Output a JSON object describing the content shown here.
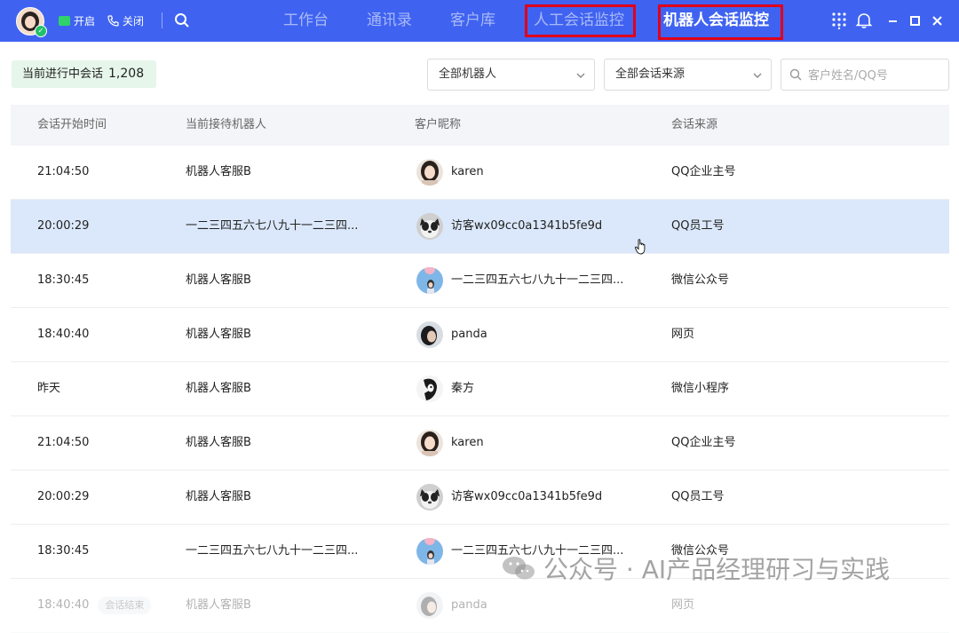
{
  "topbar": {
    "open_label": "开启",
    "close_label": "关闭",
    "nav": [
      "工作台",
      "通讯录",
      "客户库",
      "人工会话监控",
      "机器人会话监控"
    ],
    "active_nav": "机器人会话监控"
  },
  "toolbar": {
    "label": "当前进行中会话",
    "count": "1,208",
    "robot_filter": "全部机器人",
    "source_filter": "全部会话来源",
    "search_placeholder": "客户姓名/QQ号"
  },
  "table": {
    "headers": [
      "会话开始时间",
      "当前接待机器人",
      "客户昵称",
      "会话来源"
    ],
    "rows": [
      {
        "time": "21:04:50",
        "robot": "机器人客服B",
        "customer": "karen",
        "avatar": "woman-avatar",
        "source": "QQ企业主号"
      },
      {
        "time": "20:00:29",
        "robot": "一二三四五六七八九十一二三四...",
        "customer": "访客wx09cc0a1341b5fe9d",
        "avatar": "cat-avatar",
        "source": "QQ员工号"
      },
      {
        "time": "18:30:45",
        "robot": "机器人客服B",
        "customer": "一二三四五六七八九十一二三四...",
        "avatar": "girl-sky-avatar",
        "source": "微信公众号"
      },
      {
        "time": "18:40:40",
        "robot": "机器人客服B",
        "customer": "panda",
        "avatar": "man-avatar",
        "source": "网页"
      },
      {
        "time": "昨天",
        "robot": "机器人客服B",
        "customer": "秦方",
        "avatar": "sketch-avatar",
        "source": "微信小程序"
      },
      {
        "time": "21:04:50",
        "robot": "机器人客服B",
        "customer": "karen",
        "avatar": "woman-avatar",
        "source": "QQ企业主号"
      },
      {
        "time": "20:00:29",
        "robot": "机器人客服B",
        "customer": "访客wx09cc0a1341b5fe9d",
        "avatar": "cat-avatar",
        "source": "QQ员工号"
      },
      {
        "time": "18:30:45",
        "robot": "一二三四五六七八九十一二三四...",
        "customer": "一二三四五六七八九十一二三四...",
        "avatar": "girl-sky-avatar",
        "source": "微信公众号"
      },
      {
        "time": "18:40:40",
        "badge": "会话结束",
        "robot": "机器人客服B",
        "customer": "panda",
        "avatar": "man-avatar",
        "source": "网页"
      }
    ]
  },
  "watermark": {
    "text": "公众号 · AI产品经理研习与实践"
  },
  "colors": {
    "topbar_bg": "#3f63f0",
    "highlight_row": "#dbe8fb",
    "count_badge_bg": "#e6f6ea",
    "annotation_red": "#e0001b"
  }
}
